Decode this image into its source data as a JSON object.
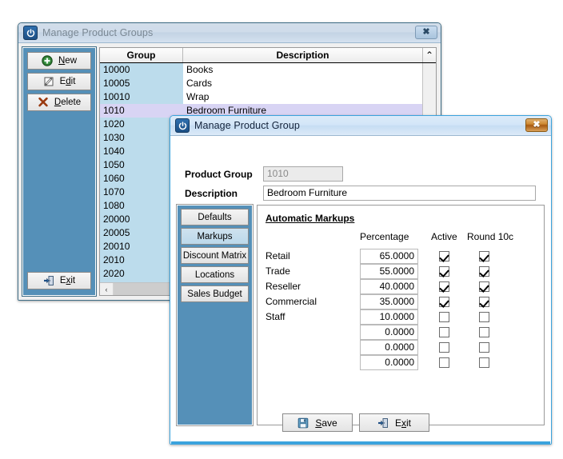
{
  "windows": {
    "groups": {
      "title": "Manage Product Groups",
      "icon": "power-icon",
      "close_label": "✖",
      "buttons": [
        {
          "label": "New",
          "accel": "N",
          "icon": "plus-circle-icon"
        },
        {
          "label": "Edit",
          "accel": "E",
          "icon": "pencil-icon"
        },
        {
          "label": "Delete",
          "accel": "D",
          "icon": "cross-icon"
        }
      ],
      "exit_button": {
        "label": "Exit",
        "accel": "x",
        "icon": "exit-door-icon"
      },
      "grid": {
        "columns": [
          "Group",
          "Description"
        ],
        "scroll_up_glyph": "⌃",
        "scroll_left_glyph": "‹",
        "selected_index": 3,
        "rows": [
          {
            "group": "10000",
            "description": "Books"
          },
          {
            "group": "10005",
            "description": "Cards"
          },
          {
            "group": "10010",
            "description": "Wrap"
          },
          {
            "group": "1010",
            "description": "Bedroom Furniture"
          },
          {
            "group": "1020",
            "description": ""
          },
          {
            "group": "1030",
            "description": ""
          },
          {
            "group": "1040",
            "description": ""
          },
          {
            "group": "1050",
            "description": ""
          },
          {
            "group": "1060",
            "description": ""
          },
          {
            "group": "1070",
            "description": ""
          },
          {
            "group": "1080",
            "description": ""
          },
          {
            "group": "20000",
            "description": ""
          },
          {
            "group": "20005",
            "description": ""
          },
          {
            "group": "20010",
            "description": ""
          },
          {
            "group": "2010",
            "description": ""
          },
          {
            "group": "2020",
            "description": ""
          }
        ]
      }
    },
    "markup": {
      "title": "Manage Product Group",
      "icon": "power-icon",
      "close_label": "✖",
      "fields": {
        "product_group_label": "Product Group",
        "product_group_value": "1010",
        "description_label": "Description",
        "description_value": "Bedroom Furniture"
      },
      "tabs": [
        {
          "label": "Defaults",
          "selected": false
        },
        {
          "label": "Markups",
          "selected": true
        },
        {
          "label": "Discount Matrix",
          "selected": false
        },
        {
          "label": "Locations",
          "selected": false
        },
        {
          "label": "Sales Budget",
          "selected": false
        }
      ],
      "markups": {
        "section_title": "Automatic Markups",
        "headers": {
          "percentage": "Percentage",
          "active": "Active",
          "round": "Round 10c"
        },
        "rows": [
          {
            "name": "Retail",
            "percentage": "65.0000",
            "active": true,
            "round": true
          },
          {
            "name": "Trade",
            "percentage": "55.0000",
            "active": true,
            "round": true
          },
          {
            "name": "Reseller",
            "percentage": "40.0000",
            "active": true,
            "round": true
          },
          {
            "name": "Commercial",
            "percentage": "35.0000",
            "active": true,
            "round": true
          },
          {
            "name": "Staff",
            "percentage": "10.0000",
            "active": false,
            "round": false
          },
          {
            "name": "",
            "percentage": "0.0000",
            "active": false,
            "round": false
          },
          {
            "name": "",
            "percentage": "0.0000",
            "active": false,
            "round": false
          },
          {
            "name": "",
            "percentage": "0.0000",
            "active": false,
            "round": false
          }
        ]
      },
      "footer_buttons": [
        {
          "label": "Save",
          "accel": "S",
          "icon": "floppy-disk-icon"
        },
        {
          "label": "Exit",
          "accel": "x",
          "icon": "exit-door-icon"
        }
      ]
    }
  },
  "colors": {
    "panel_blue": "#5590b8",
    "grid_group_bg": "#bcdcec",
    "row_selected": "#d8d4f4",
    "active_border": "#3ba3dd",
    "close_active": "#cf8a33"
  }
}
